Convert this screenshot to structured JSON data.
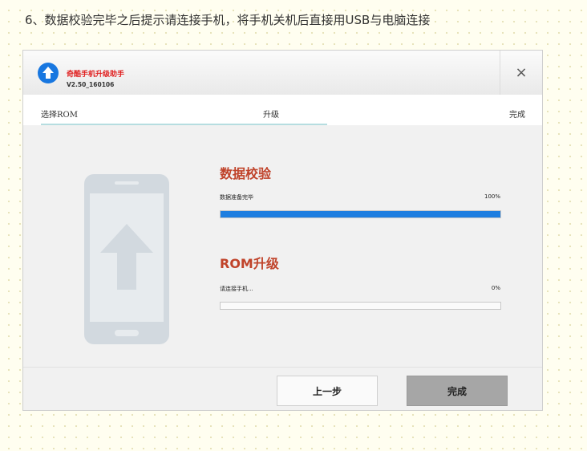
{
  "caption": "6、数据校验完毕之后提示请连接手机，将手机关机后直接用USB与电脑连接",
  "window": {
    "app_name": "奇酷手机升级助手",
    "version": "V2.50_160106",
    "close_glyph": "×"
  },
  "steps": [
    "选择ROM",
    "升级",
    "完成"
  ],
  "verify": {
    "title": "数据校验",
    "status": "数据准备完毕",
    "percent_label": "100%",
    "progress": 1.0
  },
  "rom_upgrade": {
    "title": "ROM升级",
    "status": "请连接手机...",
    "percent_label": "0%",
    "progress": 0.0
  },
  "buttons": {
    "prev": "上一步",
    "done": "完成"
  },
  "colors": {
    "accent_blue": "#1e7ee0",
    "title_red": "#c0432a",
    "logo_blue": "#1877e0"
  }
}
